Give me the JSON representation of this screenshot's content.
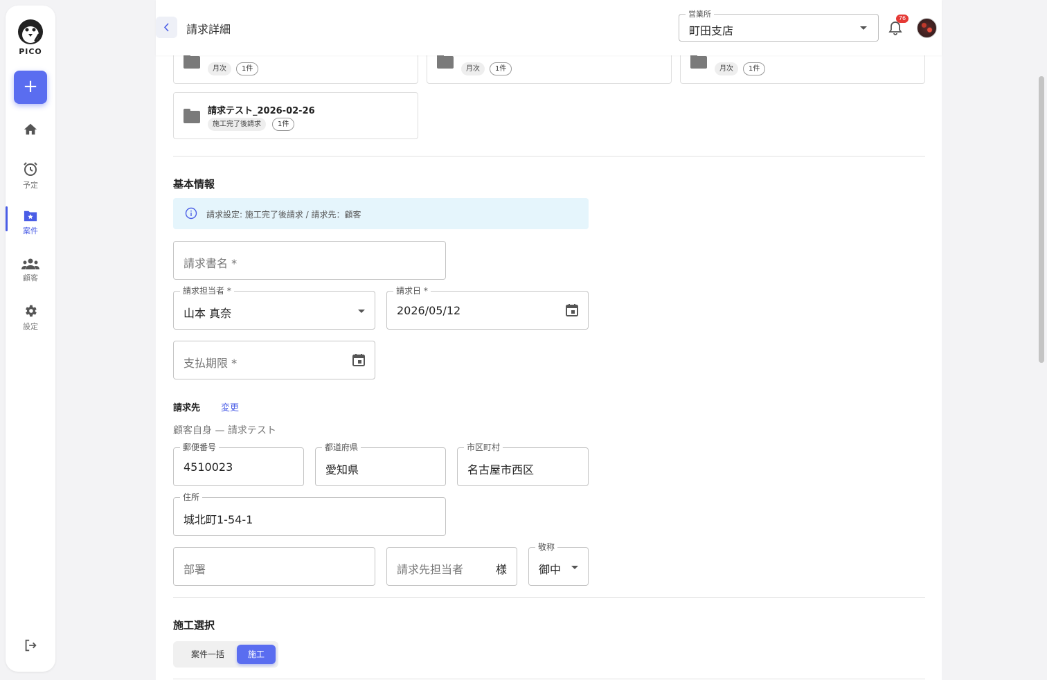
{
  "sidebar": {
    "logo_text": "PICO",
    "add_label": "+",
    "items": [
      {
        "label": ""
      },
      {
        "label": "予定"
      },
      {
        "label": "案件"
      },
      {
        "label": "顧客"
      },
      {
        "label": "設定"
      }
    ]
  },
  "header": {
    "title": "請求詳細",
    "office_label": "営業所",
    "office_value": "町田支店",
    "notification_count": "76"
  },
  "folders": [
    {
      "tags": [
        "月次",
        "1件"
      ]
    },
    {
      "tags": [
        "月次",
        "1件"
      ]
    },
    {
      "tags": [
        "月次",
        "1件"
      ]
    },
    {
      "title": "請求テスト_2026-02-26",
      "tags": [
        "施工完了後請求",
        "1件"
      ]
    }
  ],
  "basic_info": {
    "section_title": "基本情報",
    "info_text": "請求設定: 施工完了後請求 / 請求先：顧客",
    "invoice_name_placeholder": "請求書名 *",
    "assignee_label": "請求担当者 *",
    "assignee_value": "山本 真奈",
    "invoice_date_label": "請求日 *",
    "invoice_date_value": "2026/05/12",
    "due_date_placeholder": "支払期限 *"
  },
  "billing_to": {
    "title": "請求先",
    "change_link": "変更",
    "description": "顧客自身 — 請求テスト",
    "postal_label": "郵便番号",
    "postal_value": "4510023",
    "prefecture_label": "都道府県",
    "prefecture_value": "愛知県",
    "city_label": "市区町村",
    "city_value": "名古屋市西区",
    "address_label": "住所",
    "address_value": "城北町1-54-1",
    "department_placeholder": "部署",
    "contact_placeholder": "請求先担当者",
    "contact_suffix": "様",
    "honorific_label": "敬称",
    "honorific_value": "御中"
  },
  "construction": {
    "section_title": "施工選択",
    "option_all": "案件一括",
    "option_construction": "施工"
  }
}
